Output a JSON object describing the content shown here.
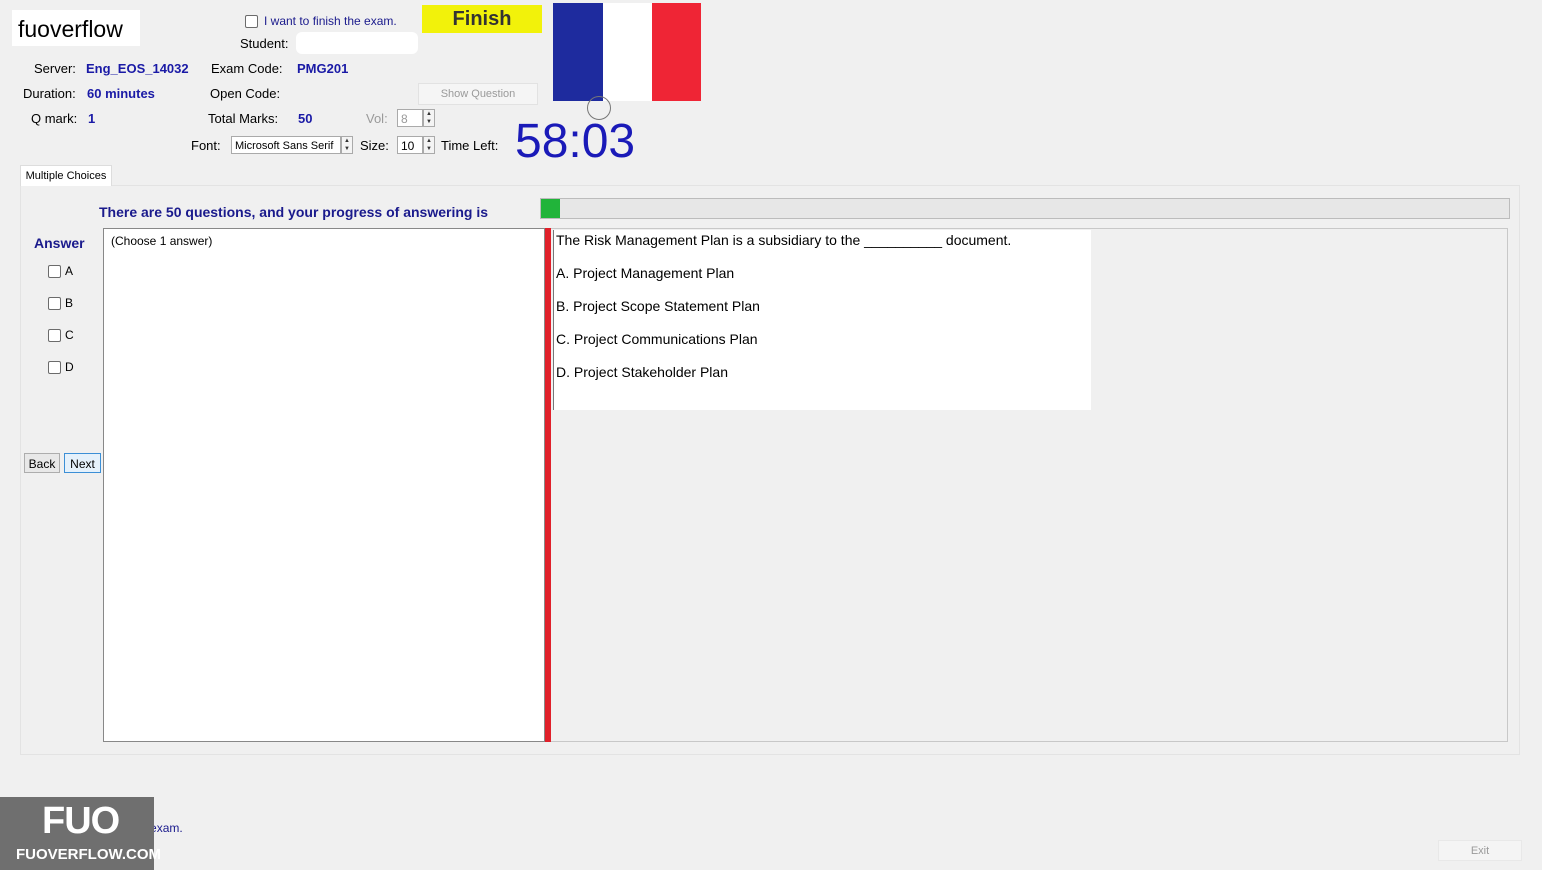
{
  "header": {
    "logo_text": "fuoverflow",
    "finish_checkbox_label": "I want to finish the exam.",
    "finish_button": "Finish",
    "student_label": "Student:",
    "student_value": "",
    "server_label": "Server:",
    "server_value": "Eng_EOS_14032",
    "exam_code_label": "Exam Code:",
    "exam_code_value": "PMG201",
    "duration_label": "Duration:",
    "duration_value": "60 minutes",
    "open_code_label": "Open Code:",
    "show_question_button": "Show Question",
    "qmark_label": "Q mark:",
    "qmark_value": "1",
    "total_marks_label": "Total Marks:",
    "total_marks_value": "50",
    "vol_label": "Vol:",
    "vol_value": "8",
    "font_label": "Font:",
    "font_value": "Microsoft Sans Serif",
    "size_label": "Size:",
    "size_value": "10",
    "time_left_label": "Time Left:",
    "timer_value": "58:03",
    "flag_colors": [
      "#1e2b9e",
      "#ffffff",
      "#ef2535"
    ]
  },
  "tab": {
    "label": "Multiple Choices"
  },
  "progress": {
    "text": "There are 50 questions, and your progress of answering is",
    "fraction": 0.02,
    "color": "#21b43a"
  },
  "answer": {
    "label": "Answer",
    "options": [
      "A",
      "B",
      "C",
      "D"
    ],
    "hint": "(Choose 1 answer)",
    "back_button": "Back",
    "next_button": "Next"
  },
  "question": {
    "text": "The Risk Management Plan is a subsidiary to the __________ document.",
    "options": [
      "A.  Project Management Plan",
      "B.  Project Scope Statement Plan",
      "C.  Project Communications Plan",
      "D.  Project Stakeholder Plan"
    ]
  },
  "footer": {
    "finish_checkbox_label": "I want to finish the exam.",
    "badge_big": "FUO",
    "badge_small": "FUOVERFLOW.COM",
    "exit_button": "Exit"
  }
}
